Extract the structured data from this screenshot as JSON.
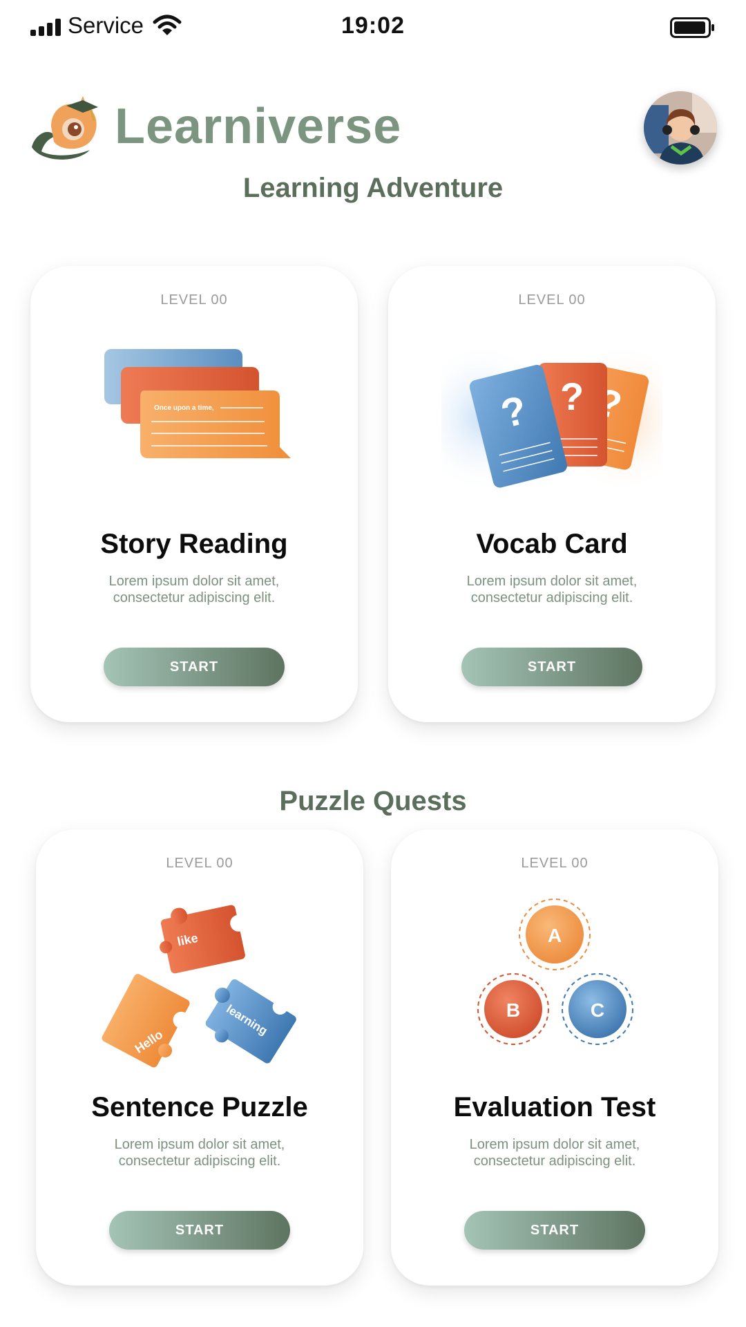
{
  "status_bar": {
    "carrier": "Service",
    "time": "19:02"
  },
  "header": {
    "brand": "Learniverse",
    "avatar_icon": "child-avatar"
  },
  "sections": [
    {
      "title": "Learning Adventure",
      "cards": [
        {
          "level": "LEVEL 00",
          "title": "Story Reading",
          "illustration_text": "Once upon a time,",
          "desc_line1": "Lorem ipsum dolor sit amet,",
          "desc_line2": "consectetur adipiscing elit.",
          "button": "START"
        },
        {
          "level": "LEVEL 00",
          "title": "Vocab Card",
          "desc_line1": "Lorem ipsum dolor sit amet,",
          "desc_line2": "consectetur adipiscing elit.",
          "button": "START"
        }
      ]
    },
    {
      "title": "Puzzle Quests",
      "cards": [
        {
          "level": "LEVEL 00",
          "title": "Sentence Puzzle",
          "pieces": [
            "like",
            "Hello",
            "learning"
          ],
          "desc_line1": "Lorem ipsum dolor sit amet,",
          "desc_line2": "consectetur adipiscing elit.",
          "button": "START"
        },
        {
          "level": "LEVEL 00",
          "title": "Evaluation Test",
          "options": [
            "A",
            "B",
            "C"
          ],
          "desc_line1": "Lorem ipsum dolor sit amet,",
          "desc_line2": "consectetur adipiscing elit.",
          "button": "START"
        }
      ]
    }
  ],
  "colors": {
    "brand_green": "#7c9580",
    "title_green": "#5b6e5c",
    "orange": "#f09a4a",
    "red_orange": "#e2633c",
    "blue": "#5c93c7",
    "button_start": "#a4c4b6",
    "button_end": "#5e7461"
  }
}
